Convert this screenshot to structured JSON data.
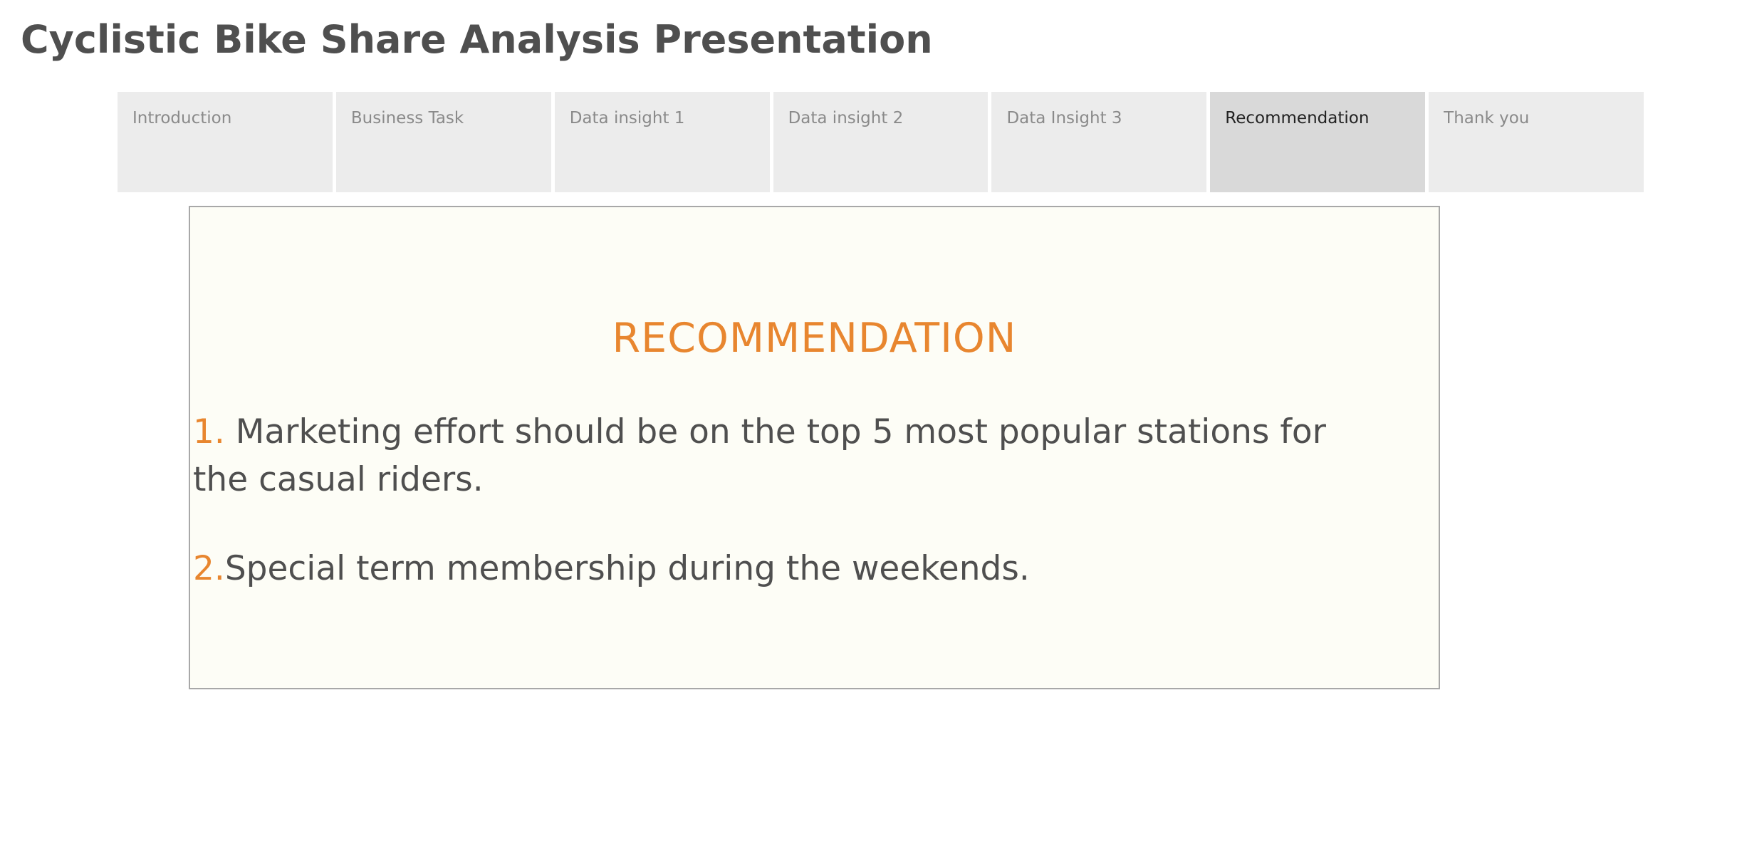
{
  "page": {
    "title": "Cyclistic Bike Share Analysis Presentation"
  },
  "tabs": [
    {
      "label": "Introduction",
      "active": false
    },
    {
      "label": "Business Task",
      "active": false
    },
    {
      "label": "Data insight 1",
      "active": false
    },
    {
      "label": "Data insight 2",
      "active": false
    },
    {
      "label": "Data Insight 3",
      "active": false
    },
    {
      "label": "Recommendation",
      "active": true
    },
    {
      "label": "Thank you",
      "active": false
    }
  ],
  "content": {
    "heading": "RECOMMENDATION",
    "items": [
      {
        "number": "1. ",
        "text": "Marketing effort should be on the top 5 most popular stations for the casual riders."
      },
      {
        "number": "2.",
        "text": "Special term membership during the weekends."
      }
    ]
  },
  "colors": {
    "accent": "#e8862f",
    "text": "#4f4f4f",
    "tab_background": "#ececec",
    "tab_active_background": "#d9d9d9",
    "box_background": "#fdfdf6",
    "box_border": "#a8a8a8"
  }
}
